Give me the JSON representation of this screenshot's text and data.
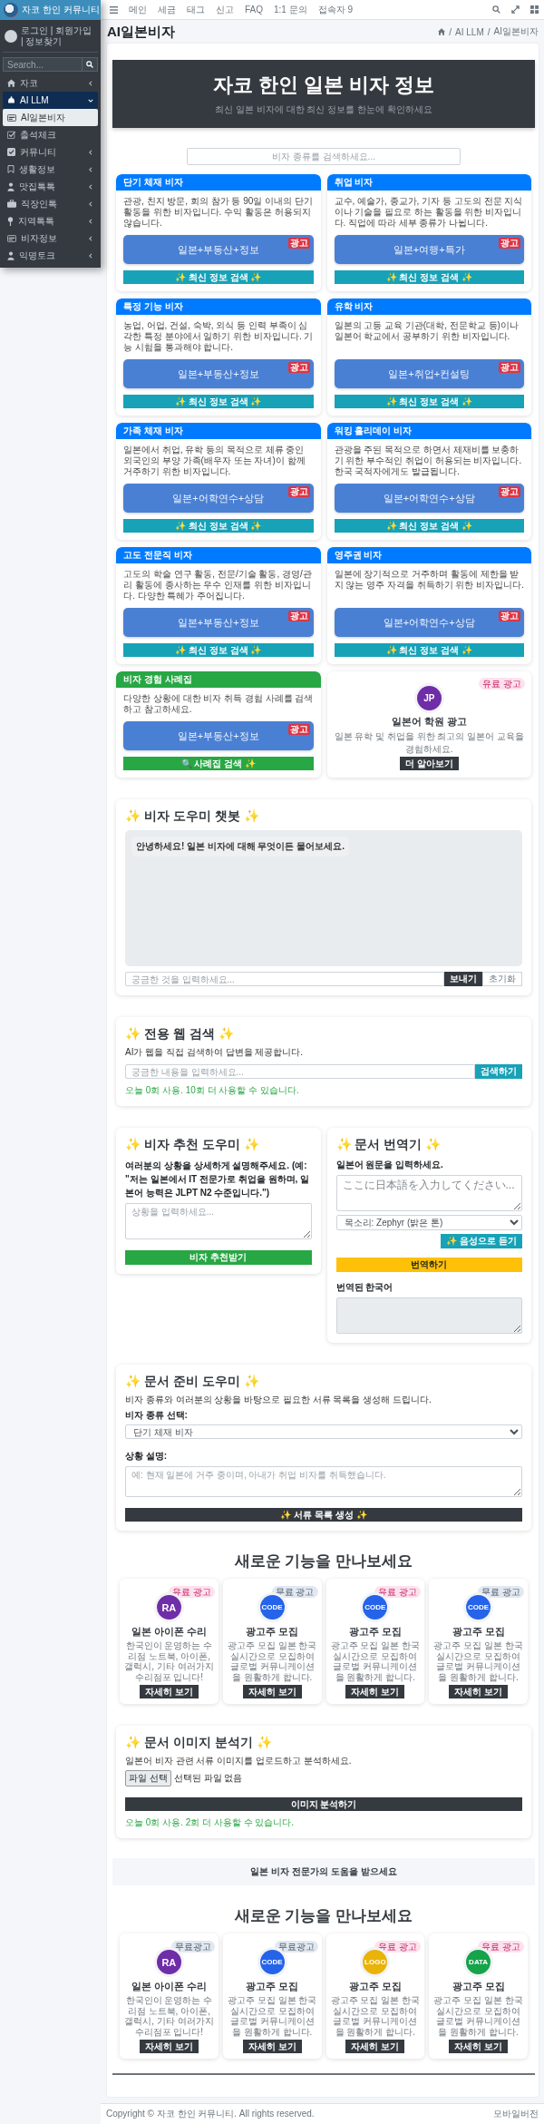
{
  "sidebar": {
    "brand": "자코 한인 커뮤니티",
    "user_links": "로그인 | 회원가입 | 정보찾기",
    "search": {
      "placeholder": "Search..."
    },
    "items": [
      {
        "label": "자코",
        "submenu": true,
        "expanded": false,
        "selected": false
      },
      {
        "label": "AI LLM",
        "submenu": true,
        "expanded": true,
        "selected": true,
        "children": [
          {
            "label": "AI일본비자",
            "selected": true
          }
        ]
      },
      {
        "label": "출석체크",
        "submenu": false,
        "expanded": false,
        "selected": false
      },
      {
        "label": "커뮤니티",
        "submenu": true,
        "expanded": false,
        "selected": false
      },
      {
        "label": "생활정보",
        "submenu": true,
        "expanded": false,
        "selected": false
      },
      {
        "label": "맛집톡톡",
        "submenu": true,
        "expanded": false,
        "selected": false
      },
      {
        "label": "직장인톡",
        "submenu": true,
        "expanded": false,
        "selected": false
      },
      {
        "label": "지역톡톡",
        "submenu": true,
        "expanded": false,
        "selected": false
      },
      {
        "label": "비자정보",
        "submenu": true,
        "expanded": false,
        "selected": false
      },
      {
        "label": "익명토크",
        "submenu": true,
        "expanded": false,
        "selected": false
      }
    ]
  },
  "header": {
    "nav": [
      "메인",
      "세금",
      "태그",
      "신고",
      "FAQ",
      "1:1 문의",
      "접속자 9"
    ]
  },
  "page_title": "AI일본비자",
  "breadcrumb": {
    "separator": "/",
    "items": [
      "AI LLM",
      "AI일본비자"
    ]
  },
  "hero": {
    "title": "자코 한인 일본 비자 정보",
    "subtitle": "최신 일본 비자에 대한 최신 정보를 한눈에 확인하세요"
  },
  "visa_search": {
    "placeholder": "비자 종류를 검색하세요..."
  },
  "visa_cards": [
    {
      "kind": "visa",
      "title": "단기 체재 비자",
      "description": "관광, 친지 방문, 회의 참가 등 90일 이내의 단기 활동을 위한 비자입니다. 수익 활동은 허용되지 않습니다.",
      "ad": "일본+부동산+정보",
      "ad_badge": "광고",
      "button": "✨ 최신 정보 검색 ✨"
    },
    {
      "kind": "visa",
      "title": "취업 비자",
      "description": "교수, 예술가, 종교가, 기자 등 고도의 전문 지식이나 기술을 필요로 하는 활동을 위한 비자입니다. 직업에 따라 세부 종류가 나뉩니다.",
      "ad": "일본+여행+특가",
      "ad_badge": "광고",
      "button": "✨ 최신 정보 검색 ✨"
    },
    {
      "kind": "visa",
      "title": "특정 기능 비자",
      "description": "농업, 어업, 건설, 숙박, 외식 등 인력 부족이 심각한 특정 분야에서 일하기 위한 비자입니다. 기능 시험을 통과해야 합니다.",
      "ad": "일본+부동산+정보",
      "ad_badge": "광고",
      "button": "✨ 최신 정보 검색 ✨"
    },
    {
      "kind": "visa",
      "title": "유학 비자",
      "description": "일본의 고등 교육 기관(대학, 전문학교 등)이나 일본어 학교에서 공부하기 위한 비자입니다.",
      "ad": "일본+취업+컨설팅",
      "ad_badge": "광고",
      "button": "✨ 최신 정보 검색 ✨"
    },
    {
      "kind": "visa",
      "title": "가족 체재 비자",
      "description": "일본에서 취업, 유학 등의 목적으로 체류 중인 외국인의 부양 가족(배우자 또는 자녀)이 함께 거주하기 위한 비자입니다.",
      "ad": "일본+어학연수+상담",
      "ad_badge": "광고",
      "button": "✨ 최신 정보 검색 ✨"
    },
    {
      "kind": "visa",
      "title": "워킹 홀리데이 비자",
      "description": "관광을 주된 목적으로 하면서 체재비를 보충하기 위한 부수적인 취업이 허용되는 비자입니다. 한국 국적자에게도 발급됩니다.",
      "ad": "일본+어학연수+상담",
      "ad_badge": "광고",
      "button": "✨ 최신 정보 검색 ✨"
    },
    {
      "kind": "visa",
      "title": "고도 전문직 비자",
      "description": "고도의 학술 연구 활동, 전문/기술 활동, 경영/관리 활동에 종사하는 우수 인재를 위한 비자입니다. 다양한 특혜가 주어집니다.",
      "ad": "일본+부동산+정보",
      "ad_badge": "광고",
      "button": "✨ 최신 정보 검색 ✨"
    },
    {
      "kind": "visa",
      "title": "영주권 비자",
      "description": "일본에 장기적으로 거주하며 활동에 제한을 받지 않는 영주 자격을 취득하기 위한 비자입니다.",
      "ad": "일본+어학연수+상담",
      "ad_badge": "광고",
      "button": "✨ 최신 정보 검색 ✨"
    },
    {
      "kind": "experience",
      "title": "비자 경험 사례집",
      "description": "다양한 상황에 대한 비자 취득 경험 사례를 검색하고 참고하세요.",
      "ad": "일본+부동산+정보",
      "ad_badge": "광고",
      "button": "🔍 사례집 검색 ✨"
    },
    {
      "kind": "ad",
      "badge": "유료 광고",
      "avatar": "JP",
      "color": "#6f2da8",
      "title": "일본어 학원 광고",
      "description": "일본 유학 및 취업을 위한 최고의 일본어 교육을 경험하세요.",
      "button": "더 알아보기"
    }
  ],
  "chatbot": {
    "title": "✨ 비자 도우미 챗봇 ✨",
    "messages": [
      "안녕하세요! 일본 비자에 대해 무엇이든 물어보세요."
    ],
    "placeholder": "궁금한 것을 입력하세요...",
    "send": "보내기",
    "reset": "초기화"
  },
  "web_search": {
    "title": "✨ 전용 웹 검색 ✨",
    "description": "AI가 웹을 직접 검색하여 답변을 제공합니다.",
    "placeholder": "궁금한 내용을 입력하세요...",
    "button": "검색하기",
    "usage": "오늘 0회 사용. 10회 더 사용할 수 있습니다."
  },
  "recommender": {
    "title": "✨ 비자 추천 도우미 ✨",
    "description": "여러분의 상황을 상세하게 설명해주세요. (예: \"저는 일본에서 IT 전문가로 취업을 원하며, 일본어 능력은 JLPT N2 수준입니다.\")",
    "placeholder": "상황을 입력하세요...",
    "button": "비자 추천받기"
  },
  "translator": {
    "title": "✨ 문서 번역기 ✨",
    "label": "일본어 원문을 입력하세요.",
    "placeholder": "ここに日本語を入力してください...",
    "voice": "목소리: Zephyr (밝은 톤)",
    "listen": "✨ 음성으로 듣기",
    "button": "번역하기",
    "result_label": "번역된 한국어"
  },
  "document_prep": {
    "title": "✨ 문서 준비 도우미 ✨",
    "description": "비자 종류와 여러분의 상황을 바탕으로 필요한 서류 목록을 생성해 드립니다.",
    "visa_label": "비자 종류 선택:",
    "visa_value": "단기 체재 비자",
    "situation_label": "상황 설명:",
    "placeholder": "예: 현재 일본에 거주 중이며, 아내가 취업 비자를 취득했습니다.",
    "button": "✨ 서류 목록 생성 ✨"
  },
  "new_features": {
    "title": "새로운 기능을 만나보세요",
    "cards": [
      {
        "badge": "유료 광고",
        "paid": true,
        "avatar": "RA",
        "color": "#6f2da8",
        "title": "일본 아이폰 수리",
        "description": "한국인이 운영하는 수리점 노트북, 아이폰, 갤럭시, 기타 여러가지 수리점포 입니다!",
        "button": "자세히 보기"
      },
      {
        "badge": "무료 광고",
        "paid": false,
        "avatar": "CODE",
        "color": "#2563eb",
        "title": "광고주 모집",
        "description": "광고주 모집 일본 한국 실시간으로 모집하여 글로벌 커뮤니케이션을 원활하게 합니다.",
        "button": "자세히 보기"
      },
      {
        "badge": "유료 광고",
        "paid": true,
        "avatar": "CODE",
        "color": "#2563eb",
        "title": "광고주 모집",
        "description": "광고주 모집 일본 한국 실시간으로 모집하여 글로벌 커뮤니케이션을 원활하게 합니다.",
        "button": "자세히 보기"
      },
      {
        "badge": "무료 광고",
        "paid": false,
        "avatar": "CODE",
        "color": "#2563eb",
        "title": "광고주 모집",
        "description": "광고주 모집 일본 한국 실시간으로 모집하여 글로벌 커뮤니케이션을 원활하게 합니다.",
        "button": "자세히 보기"
      }
    ]
  },
  "image_analyzer": {
    "title": "✨ 문서 이미지 분석기 ✨",
    "description": "일본어 비자 관련 서류 이미지를 업로드하고 분석하세요.",
    "file_button": "파일 선택",
    "file_status": "선택된 파일 없음",
    "button": "이미지 분석하기",
    "usage": "오늘 0회 사용. 2회 더 사용할 수 있습니다."
  },
  "banner": "일본 비자 전문가의 도움을 받으세요",
  "new_features_2": {
    "title": "새로운 기능을 만나보세요",
    "cards": [
      {
        "badge": "무료광고",
        "paid": false,
        "avatar": "RA",
        "color": "#6f2da8",
        "title": "일본 아이폰 수리",
        "description": "한국인이 운영하는 수리점 노트북, 아이폰, 갤럭시, 기타 여러가지 수리점포 입니다!",
        "button": "자세히 보기"
      },
      {
        "badge": "무료광고",
        "paid": false,
        "avatar": "CODE",
        "color": "#2563eb",
        "title": "광고주 모집",
        "description": "광고주 모집 일본 한국 실시간으로 모집하여 글로벌 커뮤니케이션을 원활하게 합니다.",
        "button": "자세히 보기"
      },
      {
        "badge": "유료 광고",
        "paid": true,
        "avatar": "LOGO",
        "color": "#eab308",
        "title": "광고주 모집",
        "description": "광고주 모집 일본 한국 실시간으로 모집하여 글로벌 커뮤니케이션을 원활하게 합니다.",
        "button": "자세히 보기"
      },
      {
        "badge": "유료 광고",
        "paid": true,
        "avatar": "DATA",
        "color": "#16a34a",
        "title": "광고주 모집",
        "description": "광고주 모집 일본 한국 실시간으로 모집하여 글로벌 커뮤니케이션을 원활하게 합니다.",
        "button": "자세히 보기"
      }
    ]
  },
  "footer": {
    "copyright": "Copyright © 자코 한인 커뮤니티. All rights reserved.",
    "mobile_link": "모바일버전"
  }
}
